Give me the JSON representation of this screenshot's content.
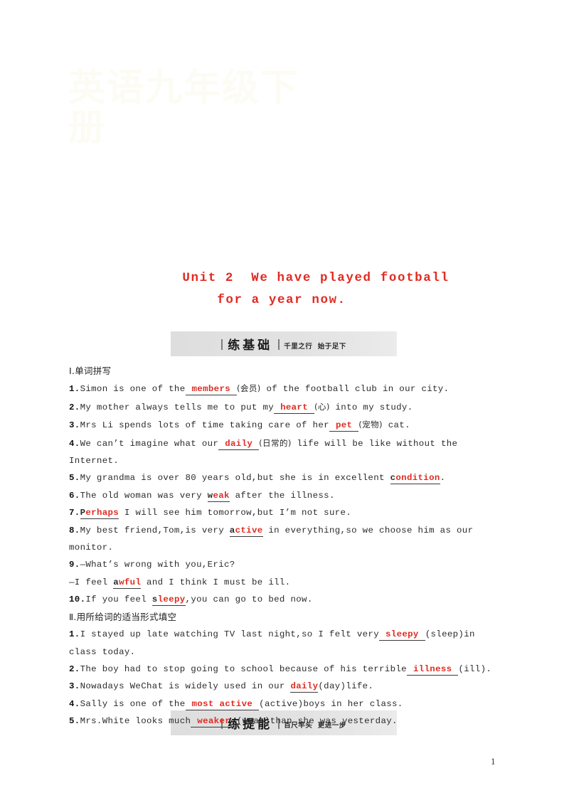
{
  "document": {
    "watermark_text": "英语九年级下册",
    "page_number": "1"
  },
  "title": {
    "line1": "Unit 2  We have played football",
    "line2": "for a year now.",
    "color": "#e02b22"
  },
  "sections": [
    {
      "bar_title": "练基础",
      "bar_subtitle": "千里之行  始于足下"
    },
    {
      "bar_title": "练提能",
      "bar_subtitle": "百尺竿头  更进一步"
    }
  ],
  "part1": {
    "heading": "Ⅰ.单词拼写",
    "items": [
      {
        "num": "1.",
        "segments": [
          {
            "t": "Simon is one of the",
            "k": "plain"
          },
          {
            "t": "members",
            "k": "blank"
          },
          {
            "t": "(会员)",
            "k": "cn"
          },
          {
            "t": " of the football club in our city.",
            "k": "plain"
          }
        ]
      },
      {
        "num": "2.",
        "segments": [
          {
            "t": "My mother always tells me to put my",
            "k": "plain"
          },
          {
            "t": "heart",
            "k": "blank"
          },
          {
            "t": "(心)",
            "k": "cn"
          },
          {
            "t": " into my study.",
            "k": "plain"
          }
        ]
      },
      {
        "num": "3.",
        "segments": [
          {
            "t": "Mrs Li spends lots of time taking care of her",
            "k": "plain"
          },
          {
            "t": "pet",
            "k": "blank"
          },
          {
            "t": "(宠物)",
            "k": "cn"
          },
          {
            "t": " cat.",
            "k": "plain"
          }
        ]
      },
      {
        "num": "4.",
        "segments": [
          {
            "t": "We can’t imagine what our",
            "k": "plain"
          },
          {
            "t": "daily",
            "k": "blank"
          },
          {
            "t": "(日常的)",
            "k": "cn"
          },
          {
            "t": " life will be like without the Internet.",
            "k": "plain"
          }
        ]
      },
      {
        "num": "5.",
        "segments": [
          {
            "t": "My grandma is over 80 years old,but she is in excellent ",
            "k": "plain"
          },
          {
            "t": "condition",
            "k": "inline",
            "given": "c"
          },
          {
            "t": ".",
            "k": "plain"
          }
        ]
      },
      {
        "num": "6.",
        "segments": [
          {
            "t": "The old woman was very ",
            "k": "plain"
          },
          {
            "t": "weak",
            "k": "inline",
            "given": "w"
          },
          {
            "t": " after the illness.",
            "k": "plain"
          }
        ]
      },
      {
        "num": "7.",
        "segments": [
          {
            "t": "",
            "k": "plain"
          },
          {
            "t": "Perhaps",
            "k": "inline",
            "given": "P"
          },
          {
            "t": " I will see him tomorrow,but I’m not sure.",
            "k": "plain"
          }
        ]
      },
      {
        "num": "8.",
        "segments": [
          {
            "t": "My best friend,Tom,is very ",
            "k": "plain"
          },
          {
            "t": "active",
            "k": "inline",
            "given": "a"
          },
          {
            "t": " in everything,so we choose him as our monitor.",
            "k": "plain"
          }
        ]
      },
      {
        "num": "9.",
        "segments": [
          {
            "t": "—What’s wrong with you,Eric?",
            "k": "plain"
          }
        ]
      },
      {
        "num": "",
        "segments": [
          {
            "t": "—I feel ",
            "k": "plain"
          },
          {
            "t": "awful",
            "k": "inline",
            "given": "a"
          },
          {
            "t": " and I think I must be ill.",
            "k": "plain"
          }
        ]
      },
      {
        "num": "10.",
        "segments": [
          {
            "t": "If you feel ",
            "k": "plain"
          },
          {
            "t": "sleepy",
            "k": "inline",
            "given": "s"
          },
          {
            "t": ",you can go to bed now.",
            "k": "plain"
          }
        ]
      }
    ]
  },
  "part2": {
    "heading": "Ⅱ.用所给词的适当形式填空",
    "items": [
      {
        "num": "1.",
        "segments": [
          {
            "t": "I stayed up late watching TV last night,so I felt very",
            "k": "plain"
          },
          {
            "t": "sleepy",
            "k": "blank"
          },
          {
            "t": "(sleep)in class today.",
            "k": "plain"
          }
        ]
      },
      {
        "num": "2.",
        "segments": [
          {
            "t": "The boy had to stop going to school because of his terrible",
            "k": "plain"
          },
          {
            "t": "illness",
            "k": "blank"
          },
          {
            "t": "(ill).",
            "k": "plain"
          }
        ]
      },
      {
        "num": "3.",
        "segments": [
          {
            "t": "Nowadays WeChat is widely used in our ",
            "k": "plain"
          },
          {
            "t": "daily",
            "k": "inline",
            "given": ""
          },
          {
            "t": "(day)life.",
            "k": "plain"
          }
        ]
      },
      {
        "num": "4.",
        "segments": [
          {
            "t": "Sally is one of the",
            "k": "plain"
          },
          {
            "t": "most active",
            "k": "blank"
          },
          {
            "t": "(active)boys in her class.",
            "k": "plain"
          }
        ]
      },
      {
        "num": "5.",
        "segments": [
          {
            "t": "Mrs.White looks much",
            "k": "plain"
          },
          {
            "t": "weaker",
            "k": "blank"
          },
          {
            "t": "(weak)than she was yesterday.",
            "k": "plain"
          }
        ]
      }
    ]
  }
}
